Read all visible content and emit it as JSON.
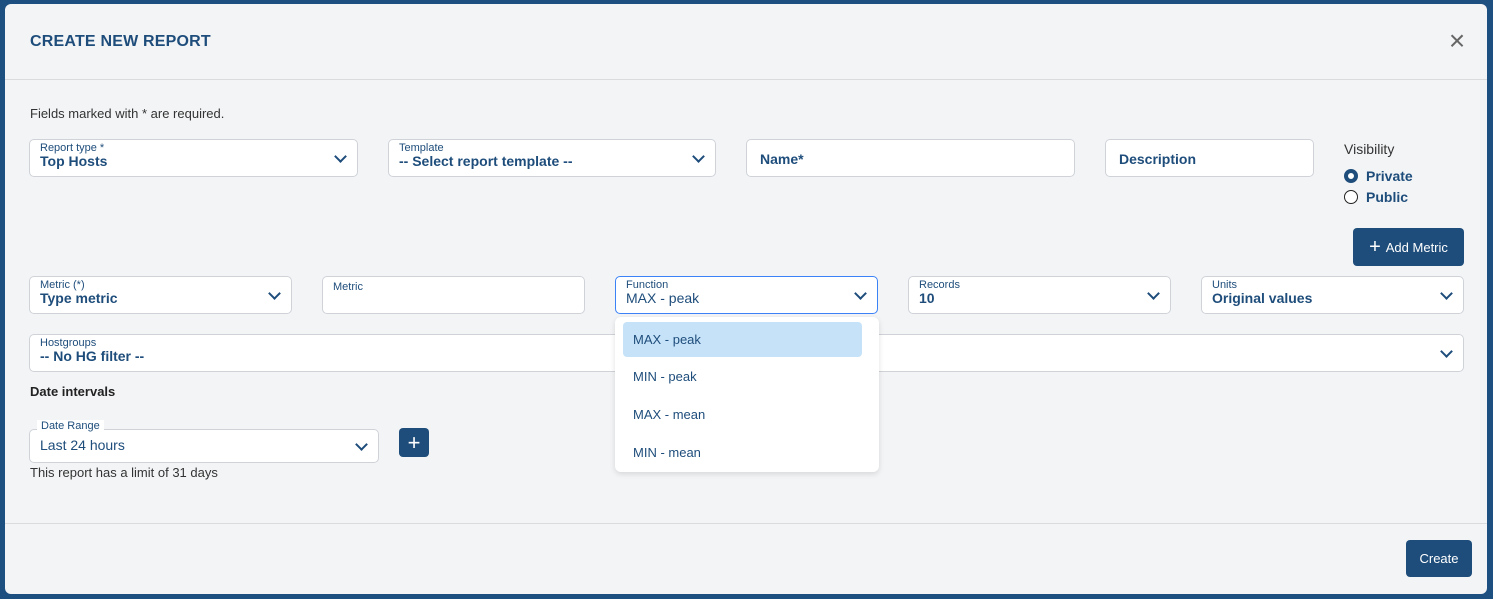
{
  "modal": {
    "title": "CREATE NEW REPORT",
    "close_icon": "close-icon",
    "required_note": "Fields marked with * are required."
  },
  "fields": {
    "report_type": {
      "label": "Report type *",
      "value": "Top Hosts"
    },
    "template": {
      "label": "Template",
      "value": "-- Select report template --"
    },
    "name": {
      "placeholder": "Name*"
    },
    "description": {
      "placeholder": "Description"
    },
    "visibility": {
      "label": "Visibility",
      "options": [
        "Private",
        "Public"
      ],
      "selected": "Private"
    }
  },
  "add_metric_label": "Add Metric",
  "metric_row": {
    "metric_select": {
      "label": "Metric (*)",
      "value": "Type metric"
    },
    "metric_input": {
      "label": "Metric",
      "value": ""
    },
    "function": {
      "label": "Function",
      "value": "MAX - peak",
      "options": [
        "MAX - peak",
        "MIN - peak",
        "MAX - mean",
        "MIN - mean"
      ]
    },
    "records": {
      "label": "Records",
      "value": "10"
    },
    "units": {
      "label": "Units",
      "value": "Original values"
    }
  },
  "hostgroups": {
    "label": "Hostgroups",
    "value": "-- No HG filter --"
  },
  "date_intervals": {
    "title": "Date intervals",
    "date_range": {
      "label": "Date Range",
      "value": "Last 24 hours"
    },
    "limit_note": "This report has a limit of 31 days"
  },
  "create_label": "Create",
  "colors": {
    "primary": "#1e4d7b",
    "option_selected": "#c6e2f8",
    "modal_bg": "#f3f4f6"
  }
}
